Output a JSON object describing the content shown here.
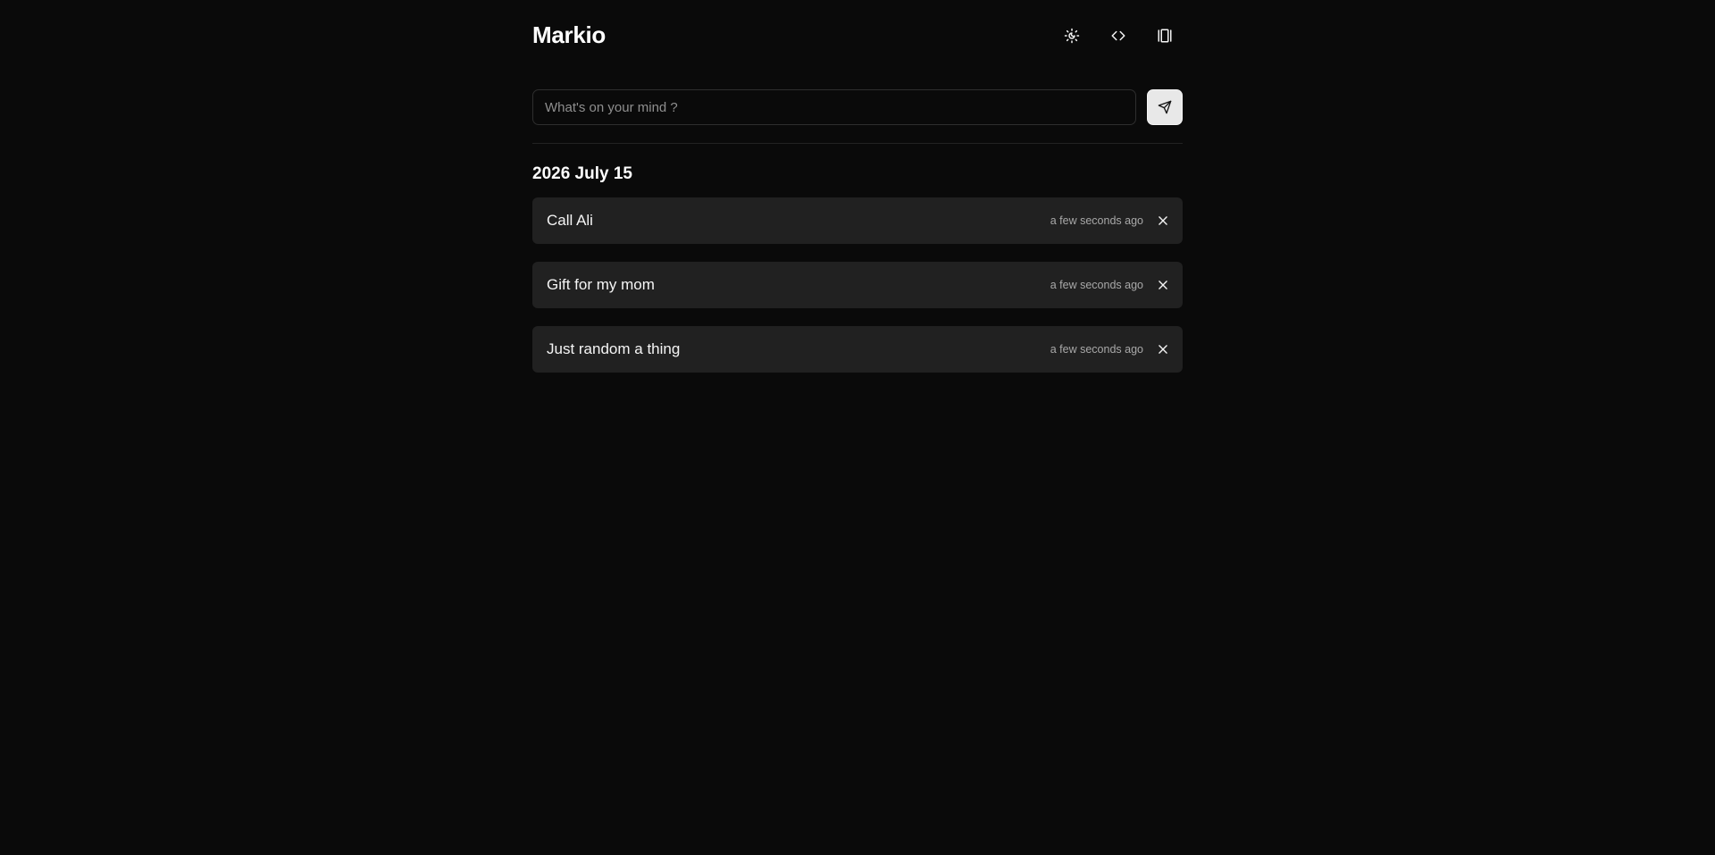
{
  "app": {
    "title": "Markio"
  },
  "header": {
    "actions": [
      {
        "icon": "theme-toggle-icon"
      },
      {
        "icon": "code-icon"
      },
      {
        "icon": "layout-panel-icon"
      }
    ]
  },
  "composer": {
    "placeholder": "What's on your mind ?",
    "value": "",
    "send_icon": "send-icon"
  },
  "sections": [
    {
      "date": "2026 July 15",
      "notes": [
        {
          "text": "Call Ali",
          "time": "a few seconds ago"
        },
        {
          "text": "Gift for my mom",
          "time": "a few seconds ago"
        },
        {
          "text": "Just random a thing",
          "time": "a few seconds ago"
        }
      ]
    }
  ],
  "colors": {
    "background": "#0a0a0a",
    "card": "#212121",
    "text": "#fafafa",
    "muted": "#a8a8a8",
    "send_button": "#e8e8e8"
  }
}
